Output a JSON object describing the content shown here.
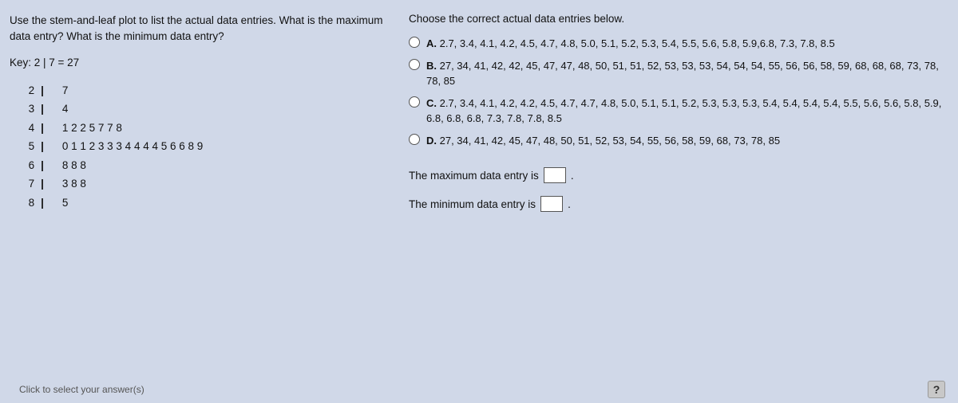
{
  "question": {
    "main": "Use the stem-and-leaf plot to list the actual data entries. What is the maximum data entry? What is the minimum data entry?",
    "key": "Key: 2 | 7 = 27"
  },
  "stemleaf": {
    "rows": [
      {
        "stem": "2",
        "leaf": "7"
      },
      {
        "stem": "3",
        "leaf": "4"
      },
      {
        "stem": "4",
        "leaf": "1 2 2 5 7 7 8"
      },
      {
        "stem": "5",
        "leaf": "0 1 1 2 3 3 3 4 4 4 4 5 6 6 8 9"
      },
      {
        "stem": "6",
        "leaf": "8 8 8"
      },
      {
        "stem": "7",
        "leaf": "3 8 8"
      },
      {
        "stem": "8",
        "leaf": "5"
      }
    ]
  },
  "right": {
    "header": "Choose the correct actual data entries below.",
    "options": [
      {
        "label": "A.",
        "text": "2.7, 3.4, 4.1, 4.2, 4.5, 4.7, 4.8, 5.0,  5.1, 5.2, 5.3, 5.4, 5.5, 5.6, 5.8, 5.9,6.8, 7.3,  7.8,  8.5"
      },
      {
        "label": "B.",
        "text": "27, 34, 41, 42, 42, 45, 47, 47, 48, 50, 51, 51, 52, 53, 53, 53, 54, 54, 54, 55, 56, 56, 58, 59, 68, 68, 68, 73, 78, 78, 85"
      },
      {
        "label": "C.",
        "text": "2.7, 3.4, 4.1, 4.2, 4.2, 4.5, 4.7, 4.7, 4.8, 5.0, 5.1, 5.1, 5.2, 5.3, 5.3, 5.3, 5.4, 5.4, 5.4, 5.4, 5.5, 5.6, 5.6, 5.8, 5.9, 6.8, 6.8, 6.8, 7.3, 7.8, 7.8, 8.5"
      },
      {
        "label": "D.",
        "text": "27, 34, 41, 42, 45, 47, 48, 50, 51, 52, 53, 54, 55, 56, 58, 59, 68, 73, 78, 85"
      }
    ],
    "max_entry_label": "The maximum data entry is",
    "min_entry_label": "The minimum data entry is"
  },
  "bottom": {
    "click_label": "Click to select your answer(s)",
    "help_btn": "?"
  }
}
